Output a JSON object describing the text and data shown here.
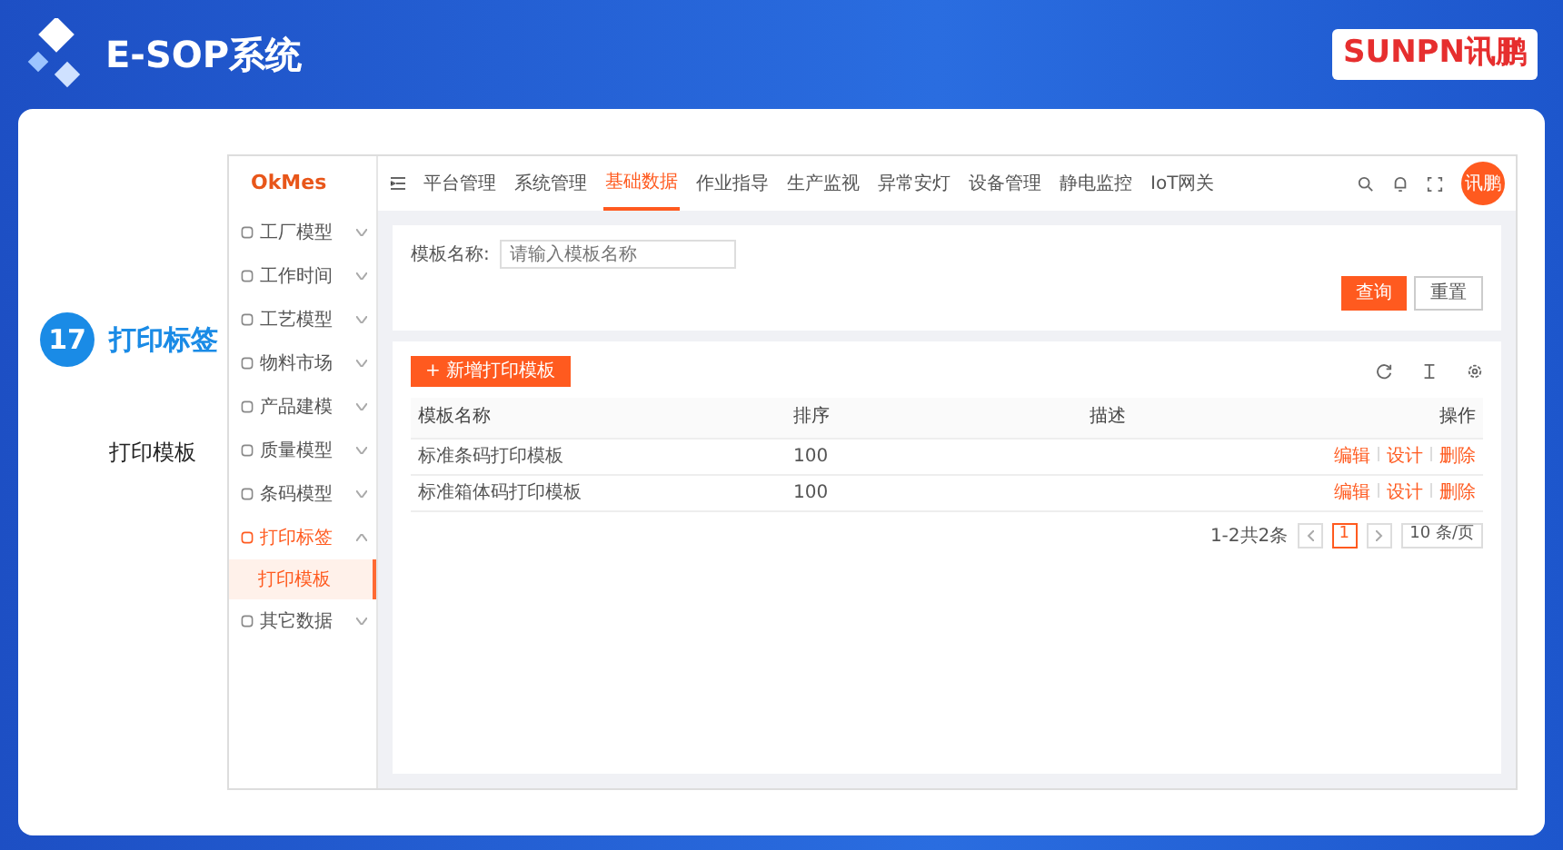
{
  "header": {
    "title": "E-SOP系统",
    "brand_left": "SUNPN",
    "brand_right": "讯鹏"
  },
  "step": {
    "number": "17",
    "title": "打印标签",
    "subtitle": "打印模板"
  },
  "app": {
    "logo": "OkMes",
    "top_nav": [
      {
        "label": "平台管理",
        "selected": false
      },
      {
        "label": "系统管理",
        "selected": false
      },
      {
        "label": "基础数据",
        "selected": true
      },
      {
        "label": "作业指导",
        "selected": false
      },
      {
        "label": "生产监视",
        "selected": false
      },
      {
        "label": "异常安灯",
        "selected": false
      },
      {
        "label": "设备管理",
        "selected": false
      },
      {
        "label": "静电监控",
        "selected": false
      },
      {
        "label": "IoT网关",
        "selected": false
      }
    ],
    "avatar": "讯鹏",
    "sidebar": [
      {
        "label": "工厂模型",
        "expanded": false,
        "selected": false
      },
      {
        "label": "工作时间",
        "expanded": false,
        "selected": false
      },
      {
        "label": "工艺模型",
        "expanded": false,
        "selected": false
      },
      {
        "label": "物料市场",
        "expanded": false,
        "selected": false
      },
      {
        "label": "产品建模",
        "expanded": false,
        "selected": false
      },
      {
        "label": "质量模型",
        "expanded": false,
        "selected": false
      },
      {
        "label": "条码模型",
        "expanded": false,
        "selected": false
      },
      {
        "label": "打印标签",
        "expanded": true,
        "selected": true,
        "children": [
          {
            "label": "打印模板",
            "selected": true
          }
        ]
      },
      {
        "label": "其它数据",
        "expanded": false,
        "selected": false
      }
    ],
    "filter": {
      "label": "模板名称:",
      "placeholder": "请输入模板名称",
      "buttons": [
        {
          "label": "查询",
          "kind": "primary"
        },
        {
          "label": "重置",
          "kind": "secondary"
        }
      ]
    },
    "add_button": "+ 新增打印模板",
    "table": {
      "columns": [
        "模板名称",
        "排序",
        "描述",
        "操作"
      ],
      "rows": [
        {
          "name": "标准条码打印模板",
          "order": "100",
          "actions": [
            "编辑",
            "设计",
            "删除"
          ]
        },
        {
          "name": "标准箱体码打印模板",
          "order": "100",
          "actions": [
            "编辑",
            "设计",
            "删除"
          ]
        }
      ]
    },
    "pagination": {
      "summary": "1-2共2条",
      "pages": [
        {
          "label": "1",
          "selected": true
        }
      ],
      "page_size": "10 条/页"
    }
  }
}
